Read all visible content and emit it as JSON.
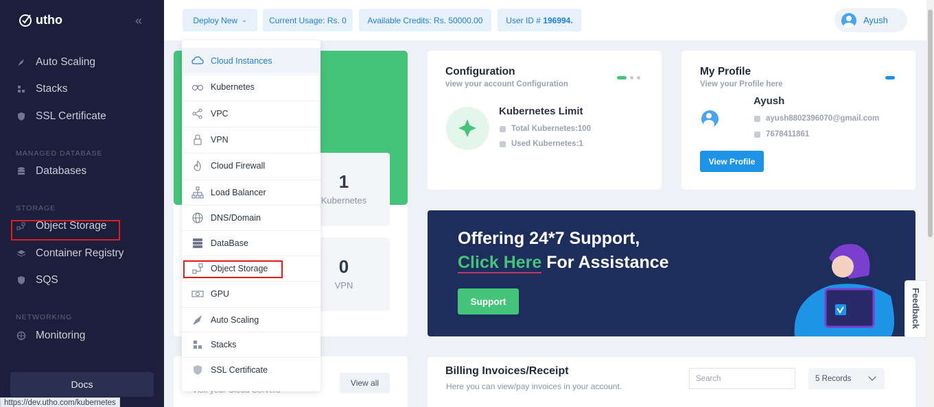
{
  "sidebar": {
    "brand": "utho",
    "items": [
      {
        "label": "Auto Scaling",
        "icon": "rocket-icon"
      },
      {
        "label": "Stacks",
        "icon": "stacks-icon"
      },
      {
        "label": "SSL Certificate",
        "icon": "shield-icon"
      },
      {
        "label": "Databases",
        "icon": "database-icon"
      },
      {
        "label": "Object Storage",
        "icon": "object-storage-icon"
      },
      {
        "label": "Container Registry",
        "icon": "layers-icon"
      },
      {
        "label": "SQS",
        "icon": "queue-icon"
      },
      {
        "label": "Monitoring",
        "icon": "globe-icon"
      }
    ],
    "sections": {
      "managed_database": "MANAGED DATABASE",
      "storage": "STORAGE",
      "networking": "NETWORKING"
    },
    "docs_label": "Docs",
    "status_url": "https://dev.utho.com/kubernetes"
  },
  "topbar": {
    "deploy_label": "Deploy New",
    "current_usage": "Current Usage: Rs. 0",
    "available_credits": "Available Credits: Rs. 50000.00",
    "user_id_prefix": "User ID # ",
    "user_id": "196994.",
    "user_name": "Ayush"
  },
  "deploy_menu": [
    {
      "label": "Cloud Instances",
      "icon": "cloud-icon",
      "active": true
    },
    {
      "label": "Kubernetes",
      "icon": "kubernetes-icon"
    },
    {
      "label": "VPC",
      "icon": "share-icon"
    },
    {
      "label": "VPN",
      "icon": "lock-icon"
    },
    {
      "label": "Cloud Firewall",
      "icon": "firewall-icon"
    },
    {
      "label": "Load Balancer",
      "icon": "load-balancer-icon"
    },
    {
      "label": "DNS/Domain",
      "icon": "globe-icon"
    },
    {
      "label": "DataBase",
      "icon": "database-icon"
    },
    {
      "label": "Object Storage",
      "icon": "object-storage-icon"
    },
    {
      "label": "GPU",
      "icon": "gpu-icon"
    },
    {
      "label": "Auto Scaling",
      "icon": "rocket-icon"
    },
    {
      "label": "Stacks",
      "icon": "stacks-icon"
    },
    {
      "label": "SSL Certificate",
      "icon": "shield-icon"
    }
  ],
  "stats": [
    {
      "value": "1",
      "label": "Kubernetes"
    },
    {
      "value": "0",
      "label": "VPN"
    }
  ],
  "servers_card": {
    "subtitle": "Visit your Cloud Servers",
    "view_all": "View all"
  },
  "configuration": {
    "title": "Configuration",
    "subtitle": "view your account Configuration",
    "limit_title": "Kubernetes Limit",
    "total": "Total Kubernetes:100",
    "used": "Used Kubernetes:1"
  },
  "profile": {
    "title": "My Profile",
    "subtitle": "View your Profile here",
    "name": "Ayush",
    "email": "ayush8802396070@gmail.com",
    "phone": "7678411861",
    "button": "View Profile"
  },
  "banner": {
    "line1": "Offering 24*7 Support,",
    "click_here": "Click Here",
    "line2_rest": " For Assistance",
    "button": "Support"
  },
  "feedback_label": "Feedback",
  "billing": {
    "title": "Billing Invoices/Receipt",
    "subtitle": "Here you can view/pay invoices in your account.",
    "search_placeholder": "Search",
    "records_label": "5 Records"
  },
  "colors": {
    "sidebar_bg": "#1b1f3b",
    "accent_green": "#46c37b",
    "accent_blue": "#1e94e8",
    "banner_bg": "#1d2d5c",
    "highlight_red": "#e01e1e"
  }
}
